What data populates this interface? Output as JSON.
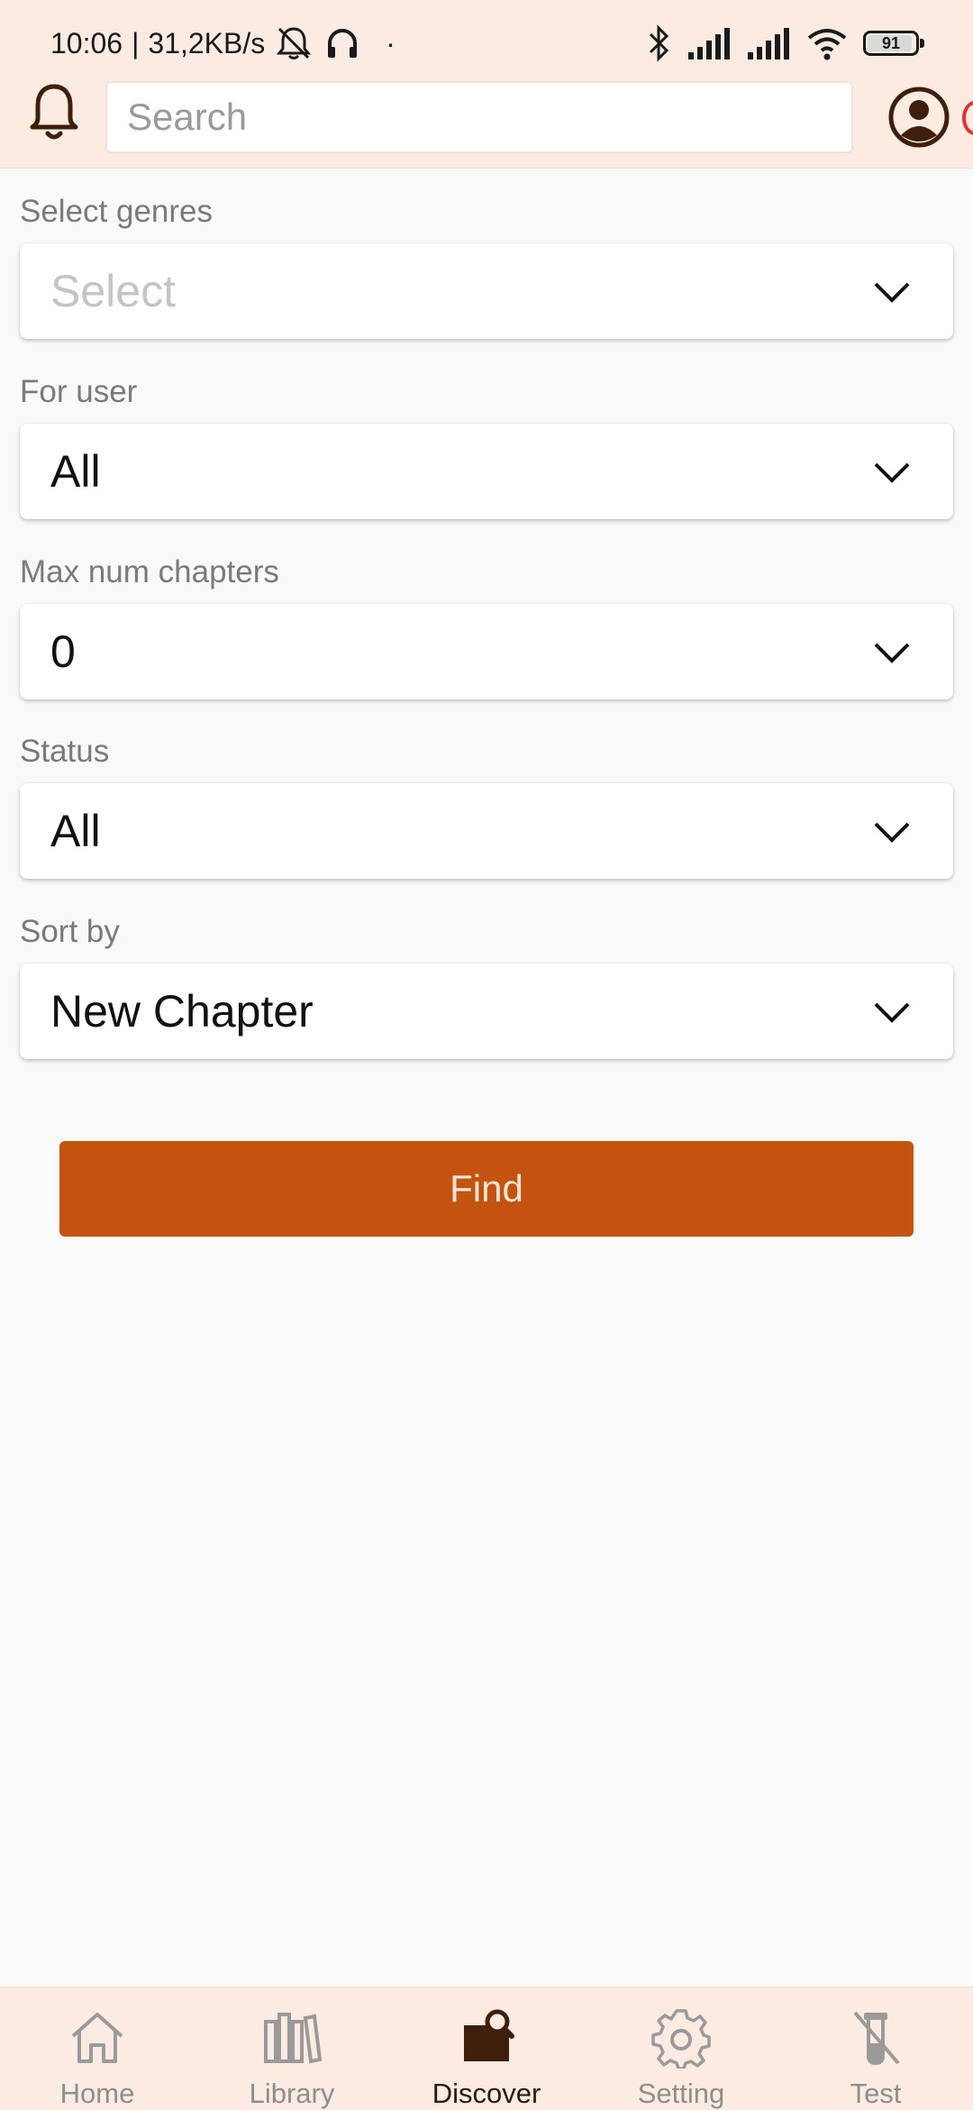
{
  "status_bar": {
    "time": "10:06",
    "separator": "|",
    "network_speed": "31,2KB/s",
    "dot": "·",
    "battery_level": "91"
  },
  "app_bar": {
    "search_placeholder": "Search",
    "icons": [
      "bell-icon",
      "account-circle-icon"
    ]
  },
  "filters": [
    {
      "label": "Select genres",
      "value": "Select",
      "is_placeholder": true
    },
    {
      "label": "For user",
      "value": "All"
    },
    {
      "label": "Max num chapters",
      "value": "0"
    },
    {
      "label": "Status",
      "value": "All"
    },
    {
      "label": "Sort by",
      "value": "New Chapter"
    }
  ],
  "find_button": {
    "label": "Find"
  },
  "bottom_nav": {
    "items": [
      {
        "label": "Home",
        "icon": "home-icon"
      },
      {
        "label": "Library",
        "icon": "library-icon"
      },
      {
        "label": "Discover",
        "icon": "discover-icon",
        "active": true
      },
      {
        "label": "Setting",
        "icon": "gear-icon"
      },
      {
        "label": "Test",
        "icon": "test-tube-icon"
      }
    ]
  },
  "colors": {
    "accent": "#c3530e",
    "bar_background": "#fcebe0",
    "page_background": "#f9f9f9",
    "active_nav": "#3d1f0b",
    "inactive_nav": "#8e8e8e"
  }
}
